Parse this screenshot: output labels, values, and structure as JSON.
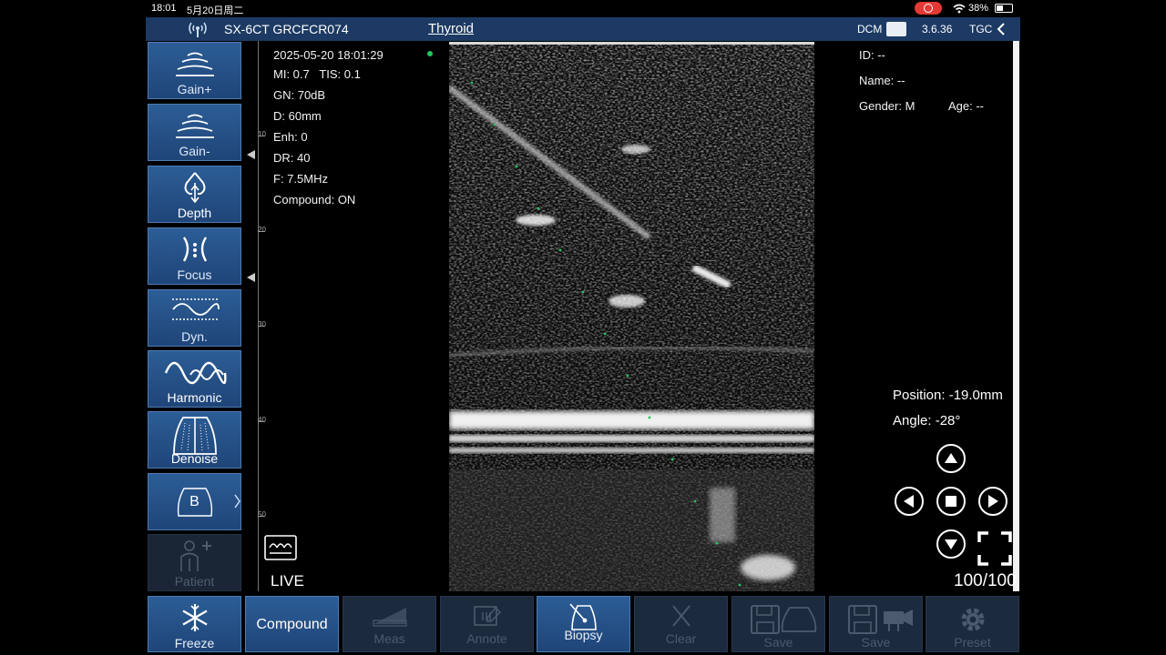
{
  "status_bar": {
    "time": "18:01",
    "date": "5月20日周二",
    "wifi": "wifi-icon",
    "battery": "38%"
  },
  "header": {
    "device": "SX-6CT GRCFCR074",
    "preset": "Thyroid",
    "dcm": "DCM",
    "version": "3.6.36",
    "tgc": "TGC"
  },
  "sidebar": {
    "gain_plus": "Gain+",
    "gain_minus": "Gain-",
    "depth": "Depth",
    "focus": "Focus",
    "dyn": "Dyn.",
    "harmonic": "Harmonic",
    "denoise": "Denoise",
    "mode": "B",
    "patient": "Patient"
  },
  "scan_info": {
    "datetime": "2025-05-20 18:01:29",
    "mi_tis": "MI: 0.7   TIS: 0.1",
    "gain": "GN: 70dB",
    "depth": "D: 60mm",
    "enh": "Enh: 0",
    "dr": "DR: 40",
    "freq": "F: 7.5MHz",
    "compound": "Compound: ON"
  },
  "ruler": {
    "ticks": [
      "10",
      "20",
      "30",
      "40",
      "50"
    ]
  },
  "live_label": "LIVE",
  "patient": {
    "id": "ID: --",
    "name": "Name: --",
    "gender": "Gender: M",
    "age": "Age: --"
  },
  "needle": {
    "position": "Position: -19.0mm",
    "angle": "Angle: -28°"
  },
  "frame_counter": "100/100",
  "bottom_bar": {
    "freeze": "Freeze",
    "compound": "Compound",
    "meas": "Meas",
    "annote": "Annote",
    "biopsy": "Biopsy",
    "clear": "Clear",
    "save_image": "Save",
    "save_video": "Save",
    "preset": "Preset"
  },
  "colors": {
    "header": "#1c3a63",
    "button": "#2c5d96",
    "guide": "#22c55e"
  }
}
